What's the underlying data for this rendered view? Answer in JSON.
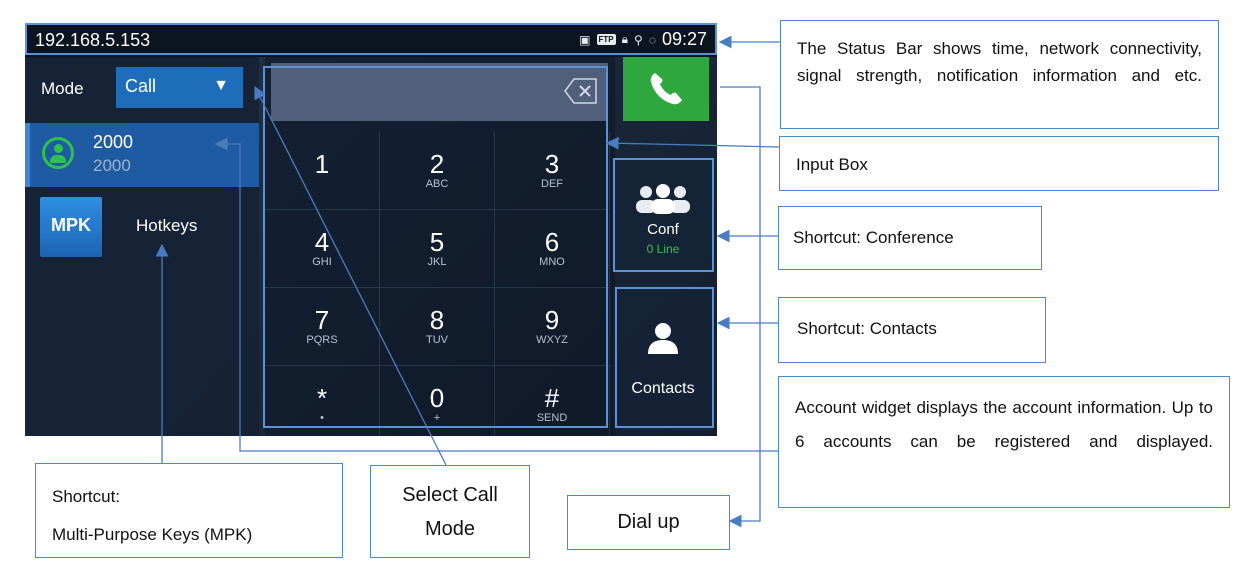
{
  "status_bar": {
    "ip": "192.168.5.153",
    "time": "09:27",
    "icons": [
      "image-icon",
      "ftp-icon",
      "lock-icon",
      "usb-icon",
      "sync-icon"
    ],
    "ftp_text": "FTP"
  },
  "mode": {
    "label": "Mode",
    "value": "Call"
  },
  "account": {
    "name": "2000",
    "number": "2000"
  },
  "mpk": {
    "badge": "MPK",
    "label": "Hotkeys"
  },
  "keypad": [
    {
      "digit": "1",
      "sub": ""
    },
    {
      "digit": "2",
      "sub": "ABC"
    },
    {
      "digit": "3",
      "sub": "DEF"
    },
    {
      "digit": "4",
      "sub": "GHI"
    },
    {
      "digit": "5",
      "sub": "JKL"
    },
    {
      "digit": "6",
      "sub": "MNO"
    },
    {
      "digit": "7",
      "sub": "PQRS"
    },
    {
      "digit": "8",
      "sub": "TUV"
    },
    {
      "digit": "9",
      "sub": "WXYZ"
    },
    {
      "digit": "*",
      "sub": "•"
    },
    {
      "digit": "0",
      "sub": "+"
    },
    {
      "digit": "#",
      "sub": "SEND"
    }
  ],
  "shortcuts": {
    "conf_label": "Conf",
    "conf_sub": "0 Line",
    "contacts_label": "Contacts"
  },
  "callouts": {
    "status_bar": "The Status Bar shows time, network connectivity, signal strength, notification information and etc.",
    "input_box": "Input Box",
    "conference": "Shortcut: Conference",
    "contacts": "Shortcut: Contacts",
    "account_widget": "Account widget displays the account information. Up to 6 accounts can be registered and displayed.",
    "dial_up": "Dial up",
    "select_call_mode_1": "Select Call",
    "select_call_mode_2": "Mode",
    "mpk_1": "Shortcut:",
    "mpk_2": "Multi-Purpose Keys (MPK)"
  },
  "colors": {
    "accent": "#1e6db8",
    "call_green": "#2ea73e",
    "callout_border": "#4f86d0"
  }
}
